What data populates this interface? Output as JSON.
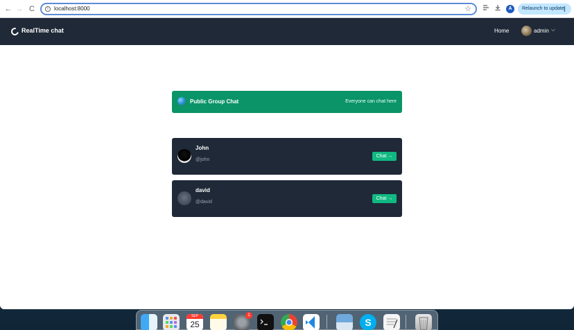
{
  "browser": {
    "url": "localhost:8000",
    "relaunch_label": "Relaunch to update",
    "profile_initial": "A",
    "back_glyph": "←",
    "forward_glyph": "→",
    "reload_glyph": "C",
    "info_glyph": "i",
    "star_glyph": "☆",
    "menu_glyph": "⋮"
  },
  "navbar": {
    "brand": "RealTime chat",
    "home_label": "Home",
    "user_name": "admin",
    "chevron_glyph": "⌵"
  },
  "group_chat": {
    "title": "Public Group Chat",
    "subtitle": "Everyone can chat here"
  },
  "users": [
    {
      "name": "John",
      "handle": "@john",
      "button_label": "Chat →"
    },
    {
      "name": "david",
      "handle": "@david",
      "button_label": "Chat →"
    }
  ],
  "dock": {
    "calendar_month": "SEP",
    "calendar_day": "25",
    "settings_badge": "1",
    "apps": [
      "finder-icon",
      "launchpad-icon",
      "calendar-icon",
      "notes-icon",
      "system-settings-icon",
      "terminal-icon",
      "chrome-icon",
      "vscode-icon",
      "preview-icon",
      "skype-icon",
      "textedit-icon",
      "trash-icon"
    ]
  },
  "colors": {
    "navbar_bg": "#1f2937",
    "card_bg": "#1f2937",
    "group_green": "#0a9468",
    "button_green": "#10b981",
    "relaunch_bg": "#c2e7ff"
  }
}
